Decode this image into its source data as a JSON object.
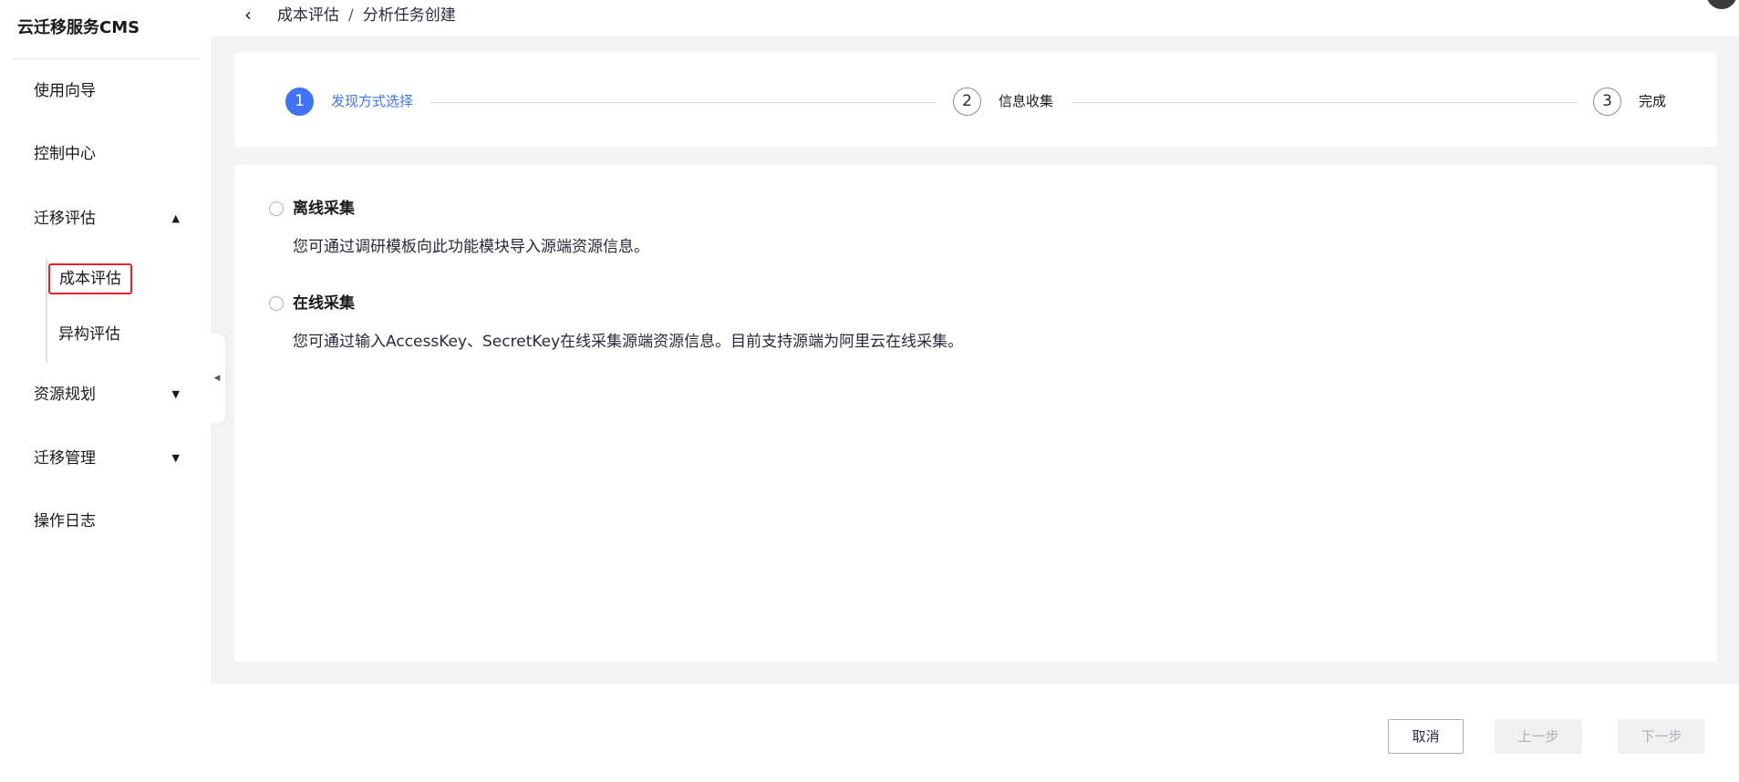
{
  "app": {
    "brand": "云迁移服务CMS"
  },
  "sidebar": {
    "items": [
      {
        "label": "使用向导"
      },
      {
        "label": "控制中心"
      },
      {
        "label": "迁移评估",
        "caret": "▲"
      },
      {
        "label": "资源规划",
        "caret": "▼"
      },
      {
        "label": "迁移管理",
        "caret": "▼"
      },
      {
        "label": "操作日志"
      }
    ],
    "sub_items": [
      {
        "label": "成本评估",
        "active": true
      },
      {
        "label": "异构评估"
      }
    ],
    "collapse_icon": "◀"
  },
  "header": {
    "back_icon": "‹",
    "breadcrumb": [
      "成本评估",
      "分析任务创建"
    ],
    "separator": "/"
  },
  "steps": [
    {
      "num": "1",
      "label": "发现方式选择",
      "active": true
    },
    {
      "num": "2",
      "label": "信息收集"
    },
    {
      "num": "3",
      "label": "完成"
    }
  ],
  "options": [
    {
      "title": "离线采集",
      "desc": "您可通过调研模板向此功能模块导入源端资源信息。"
    },
    {
      "title": "在线采集",
      "desc": "您可通过输入AccessKey、SecretKey在线采集源端资源信息。目前支持源端为阿里云在线采集。"
    }
  ],
  "footer": {
    "cancel": "取消",
    "prev": "上一步",
    "next": "下一步"
  },
  "colors": {
    "accent": "#3f74f6",
    "highlight_border": "#e8232b"
  }
}
